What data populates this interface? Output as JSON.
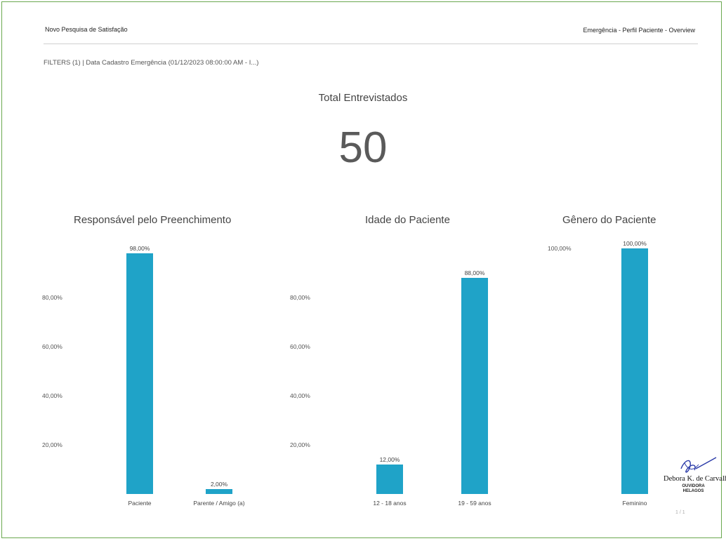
{
  "header": {
    "report_title": "Novo Pesquisa de Satisfação",
    "breadcrumb": "Emergência - Perfil Paciente - Overview"
  },
  "filters": {
    "text": "FILTERS (1) | Data Cadastro Emergência (01/12/2023 08:00:00 AM - I...)"
  },
  "kpi": {
    "title": "Total Entrevistados",
    "value": "50"
  },
  "colors": {
    "bar": "#1fa3c8",
    "frame": "#6aa84f"
  },
  "chart_data": [
    {
      "type": "bar",
      "title": "Responsável pelo Preenchimento",
      "categories": [
        "Paciente",
        "Parente / Amigo (a)"
      ],
      "values": [
        98,
        2
      ],
      "value_labels": [
        "98,00%",
        "2,00%"
      ],
      "yticks": [
        "20,00%",
        "40,00%",
        "60,00%",
        "80,00%"
      ],
      "ylim": [
        0,
        100
      ],
      "grid": false
    },
    {
      "type": "bar",
      "title": "Idade do Paciente",
      "categories": [
        "12 - 18 anos",
        "19 - 59 anos"
      ],
      "values": [
        12,
        88
      ],
      "value_labels": [
        "12,00%",
        "88,00%"
      ],
      "yticks": [
        "20,00%",
        "40,00%",
        "60,00%",
        "80,00%"
      ],
      "ylim": [
        0,
        100
      ],
      "grid": false
    },
    {
      "type": "bar",
      "title": "Gênero do Paciente",
      "categories": [
        "Feminino"
      ],
      "values": [
        100
      ],
      "value_labels": [
        "100,00%"
      ],
      "yticks": [
        "100,00%"
      ],
      "ylim": [
        0,
        100
      ],
      "grid": false
    }
  ],
  "signature": {
    "name": "Debora K. de Carvalho",
    "role": "OUVIDORA",
    "org": "HELAGOS"
  },
  "page_number": "1 / 1"
}
